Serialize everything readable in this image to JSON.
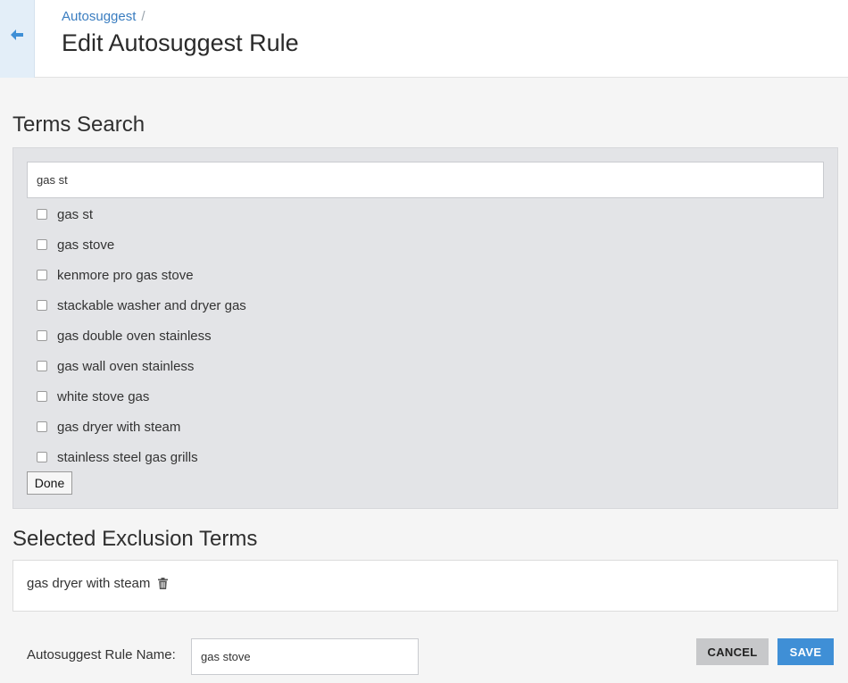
{
  "header": {
    "breadcrumb": "Autosuggest",
    "breadcrumb_separator": "/",
    "title": "Edit Autosuggest Rule",
    "back_icon": "arrow-left-icon"
  },
  "terms_search": {
    "heading": "Terms Search",
    "query": "gas st",
    "options": [
      {
        "label": "gas st",
        "checked": false
      },
      {
        "label": "gas stove",
        "checked": false
      },
      {
        "label": "kenmore pro gas stove",
        "checked": false
      },
      {
        "label": "stackable washer and dryer gas",
        "checked": false
      },
      {
        "label": "gas double oven stainless",
        "checked": false
      },
      {
        "label": "gas wall oven stainless",
        "checked": false
      },
      {
        "label": "white stove gas",
        "checked": false
      },
      {
        "label": "gas dryer with steam",
        "checked": false
      },
      {
        "label": "stainless steel gas grills",
        "checked": false
      }
    ],
    "done_label": "Done"
  },
  "selected_exclusions": {
    "heading": "Selected Exclusion Terms",
    "terms": [
      "gas dryer with steam"
    ],
    "remove_icon": "trash-icon"
  },
  "footer": {
    "rule_name_label": "Autosuggest Rule Name:",
    "rule_name_value": "gas stove",
    "cancel_label": "CANCEL",
    "save_label": "SAVE"
  },
  "colors": {
    "accent": "#3f8fd6",
    "link": "#3a7dc0",
    "panel": "#e3e4e7",
    "cancel": "#c7c8ca"
  }
}
